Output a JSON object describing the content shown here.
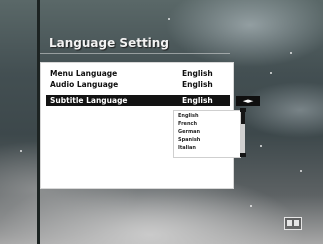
{
  "menu": {
    "title": "Language Setting",
    "items": [
      {
        "label": "Menu Language",
        "value": "English"
      },
      {
        "label": "Audio Language",
        "value": "English"
      },
      {
        "label": "Subtitle Language",
        "value": "English"
      }
    ],
    "selected_index": 2
  },
  "arrow_button": {
    "label": "◄►",
    "icon": "left-right-arrow-icon"
  },
  "dropdown": {
    "options": [
      "English",
      "French",
      "German",
      "Spanish",
      "Italian"
    ]
  },
  "corner_icon": "tv-icon",
  "colors": {
    "panel_bg": "#ffffff",
    "selection_bg": "#131313",
    "title_text": "#f2f2f2"
  }
}
